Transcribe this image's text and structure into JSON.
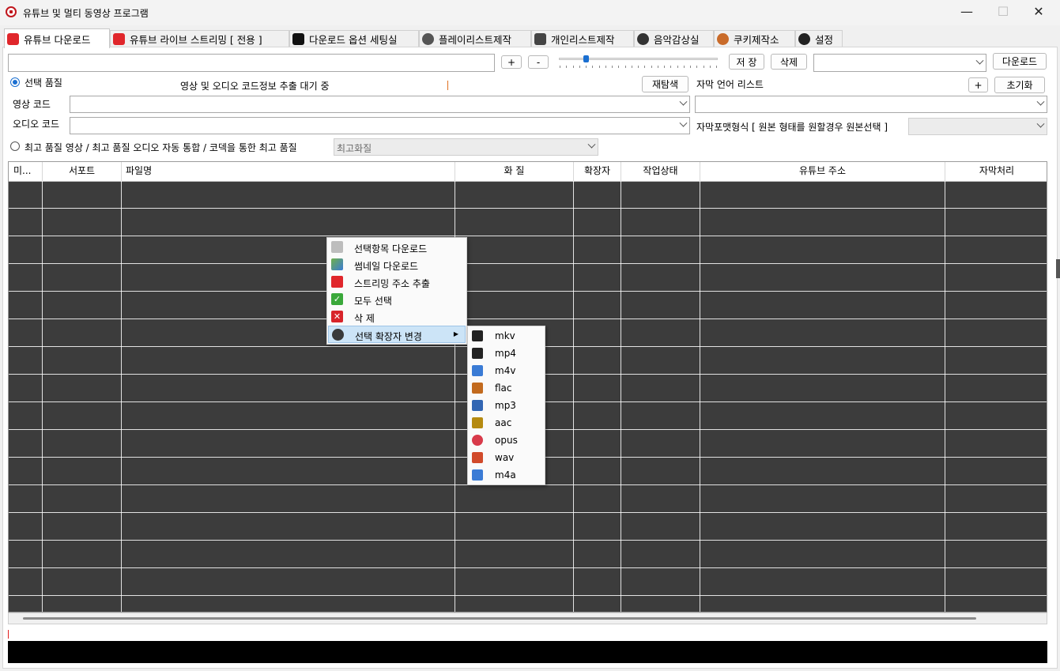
{
  "window": {
    "title": "유튜브 및 멀티 동영상 프로그램",
    "minimize_glyph": "—",
    "maximize_glyph": "☐",
    "close_glyph": "✕"
  },
  "tabs": [
    {
      "label": "유튜브 다운로드",
      "icon": "youtube-icon",
      "active": true
    },
    {
      "label": "유튜브 라이브 스트리밍 [ 전용 ]",
      "icon": "play-icon",
      "active": false
    },
    {
      "label": "다운로드 옵션 세팅실",
      "icon": "gear-icon",
      "active": false
    },
    {
      "label": "플레이리스트제작",
      "icon": "character-icon",
      "active": false
    },
    {
      "label": "개인리스트제작",
      "icon": "character-icon",
      "active": false
    },
    {
      "label": "음악감상실",
      "icon": "music-icon",
      "active": false
    },
    {
      "label": "쿠키제작소",
      "icon": "gingerbread-icon",
      "active": false
    },
    {
      "label": "설정",
      "icon": "settings-icon",
      "active": false
    }
  ],
  "toolbar": {
    "url_value": "",
    "plus_label": "+",
    "minus_label": "-",
    "slider_value": 0.17,
    "save_label": "저 장",
    "delete_label": "삭제",
    "preset_value": "",
    "download_label": "다운로드"
  },
  "quality": {
    "select_quality_label": "선택 품질",
    "status_text": "영상 및 오디오 코드정보 추출 대기 중",
    "rescan_label": "재탐색",
    "subtitle_lang_label": "자막 언어 리스트",
    "add_label": "+",
    "reset_label": "초기화",
    "video_code_label": "영상  코드",
    "audio_code_label": "오디오 코드",
    "video_code_value": "",
    "audio_code_value": "",
    "subtitle_lang_value": "",
    "subtitle_format_label": "자막포맷형식 [ 원본 형태를 원할경우 원본선택 ]",
    "subtitle_format_value": "",
    "best_quality_label": "최고 품질 영상 / 최고 품질 오디오 자동 통합 / 코덱을 통한 최고 품질",
    "best_quality_value": "최고화질"
  },
  "table": {
    "columns": [
      "미...",
      "서포트",
      "파일명",
      "화 질",
      "확장자",
      "작업상태",
      "유튜브 주소",
      "자막처리"
    ],
    "row_count": 16
  },
  "context_menu": {
    "items": [
      {
        "label": "선택항목 다운로드",
        "icon": "download-icon"
      },
      {
        "label": "썸네일 다운로드",
        "icon": "image-icon"
      },
      {
        "label": "스트리밍 주소 추출",
        "icon": "streaming-icon"
      },
      {
        "label": "모두 선택",
        "icon": "check-icon"
      },
      {
        "label": "삭 제",
        "icon": "delete-icon"
      },
      {
        "label": "선택 확장자 변경",
        "icon": "film-icon",
        "submenu": true
      }
    ],
    "submenu_arrow": "▶"
  },
  "extension_submenu": {
    "items": [
      {
        "label": "mkv",
        "icon": "mkv-icon",
        "color": "#222222"
      },
      {
        "label": "mp4",
        "icon": "mp4-icon",
        "color": "#222222"
      },
      {
        "label": "m4v",
        "icon": "m4v-icon",
        "color": "#3a7bd5"
      },
      {
        "label": "flac",
        "icon": "flac-icon",
        "color": "#c26a1e"
      },
      {
        "label": "mp3",
        "icon": "mp3-icon",
        "color": "#3266b3"
      },
      {
        "label": "aac",
        "icon": "aac-icon",
        "color": "#b58a10"
      },
      {
        "label": "opus",
        "icon": "opus-icon",
        "color": "#d83a4a"
      },
      {
        "label": "wav",
        "icon": "wav-icon",
        "color": "#d14a2a"
      },
      {
        "label": "m4a",
        "icon": "m4a-icon",
        "color": "#3a7bd5"
      }
    ]
  },
  "colors": {
    "accent": "#1a6fd1",
    "grid_bg": "#3c3c3c",
    "menu_highlight": "#cce4f7",
    "status_bar": "#000000"
  }
}
